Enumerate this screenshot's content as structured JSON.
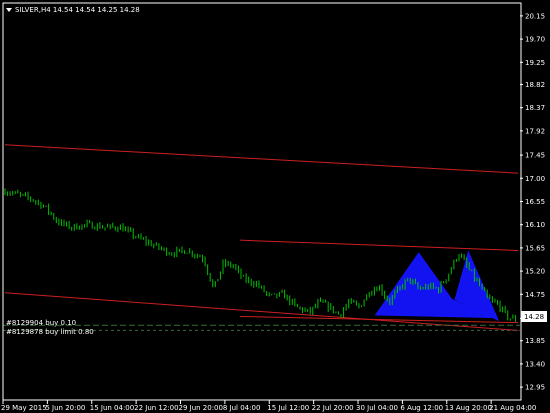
{
  "header": {
    "icon": "dropdown-triangle-icon",
    "text": "SILVER,H4 14.54 14.54 14.25 14.28"
  },
  "orders": [
    {
      "text": "#8129904 buy 0.10"
    },
    {
      "text": "#8129878 buy limit 0.80"
    }
  ],
  "chart_data": {
    "type": "candlestick",
    "symbol": "SILVER",
    "timeframe": "H4",
    "ohlc": {
      "open": 14.54,
      "high": 14.54,
      "low": 14.25,
      "close": 14.28
    },
    "y_ticks": [
      "20.15",
      "19.70",
      "19.25",
      "18.82",
      "18.37",
      "17.92",
      "17.45",
      "17.00",
      "16.55",
      "16.10",
      "15.65",
      "15.20",
      "14.75",
      "14.28",
      "13.85",
      "13.40",
      "12.95"
    ],
    "ylim": [
      12.7,
      20.4
    ],
    "x_ticks": [
      "29 May 2015",
      "5 Jun 20:00",
      "15 Jun 04:00",
      "22 Jun 12:00",
      "29 Jun 20:00",
      "8 Jul 04:00",
      "15 Jul 12:00",
      "22 Jul 20:00",
      "30 Jul 04:00",
      "6 Aug 12:00",
      "13 Aug 20:00",
      "21 Aug 04:00"
    ],
    "current_price": "14.28",
    "order_levels": [
      14.15,
      14.05
    ],
    "price_path": [
      [
        0,
        16.75
      ],
      [
        3,
        16.7
      ],
      [
        8,
        16.6
      ],
      [
        12,
        16.45
      ],
      [
        16,
        16.15
      ],
      [
        20,
        16.05
      ],
      [
        25,
        16.1
      ],
      [
        30,
        16.05
      ],
      [
        35,
        16.05
      ],
      [
        40,
        15.85
      ],
      [
        45,
        15.7
      ],
      [
        50,
        15.55
      ],
      [
        55,
        15.6
      ],
      [
        60,
        15.45
      ],
      [
        63,
        14.85
      ],
      [
        66,
        15.35
      ],
      [
        69,
        15.3
      ],
      [
        72,
        15.05
      ],
      [
        76,
        14.95
      ],
      [
        80,
        14.7
      ],
      [
        84,
        14.75
      ],
      [
        88,
        14.5
      ],
      [
        92,
        14.4
      ],
      [
        95,
        14.6
      ],
      [
        98,
        14.5
      ],
      [
        101,
        14.35
      ],
      [
        104,
        14.6
      ],
      [
        107,
        14.5
      ],
      [
        110,
        14.8
      ],
      [
        113,
        14.9
      ],
      [
        116,
        14.6
      ],
      [
        119,
        14.85
      ],
      [
        122,
        15.05
      ],
      [
        125,
        14.85
      ],
      [
        128,
        14.9
      ],
      [
        131,
        14.85
      ],
      [
        134,
        15.15
      ],
      [
        137,
        15.55
      ],
      [
        140,
        15.25
      ],
      [
        143,
        14.95
      ],
      [
        146,
        14.65
      ],
      [
        149,
        14.55
      ],
      [
        152,
        14.3
      ],
      [
        155,
        14.25
      ]
    ],
    "trend_lines": [
      {
        "color": "#cc2020",
        "from": [
          0,
          17.65
        ],
        "to": [
          155,
          17.1
        ]
      },
      {
        "color": "#cc2020",
        "from": [
          71,
          15.8
        ],
        "to": [
          155,
          15.6
        ]
      },
      {
        "color": "#cc2020",
        "from": [
          0,
          14.78
        ],
        "to": [
          155,
          14.05
        ]
      },
      {
        "color": "#cc2020",
        "from": [
          71,
          14.32
        ],
        "to": [
          155,
          14.2
        ]
      }
    ],
    "harmonic_patterns": [
      {
        "color": "#1414ff",
        "points": [
          [
            112,
            14.35
          ],
          [
            125,
            15.55
          ],
          [
            135,
            14.65
          ],
          [
            147,
            14.3
          ]
        ]
      },
      {
        "color": "#1414ff",
        "points": [
          [
            136,
            14.65
          ],
          [
            140,
            15.57
          ],
          [
            149,
            14.25
          ]
        ]
      }
    ],
    "colors": {
      "background": "#000000",
      "bull": "#00c000",
      "bear": "#00c000",
      "axis": "#ffffff",
      "grid_levels": "#3a6a3a"
    }
  }
}
